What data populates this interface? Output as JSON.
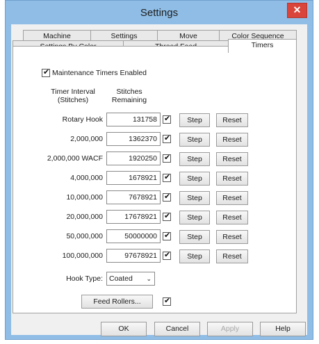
{
  "window": {
    "title": "Settings",
    "close_glyph": "✕"
  },
  "tabs_row1": [
    "Machine",
    "Settings",
    "Move",
    "Color Sequence"
  ],
  "tabs_row2": [
    "Settings By Color",
    "Thread Feed",
    "Timers"
  ],
  "active_tab": "Timers",
  "maintenance": {
    "label": "Maintenance Timers Enabled",
    "checked": true
  },
  "headers": {
    "interval_line1": "Timer Interval",
    "interval_line2": "(Stitches)",
    "remaining_line1": "Stitches",
    "remaining_line2": "Remaining"
  },
  "timers": [
    {
      "interval": "Rotary Hook",
      "remaining": "131758",
      "enabled": true
    },
    {
      "interval": "2,000,000",
      "remaining": "1362370",
      "enabled": true
    },
    {
      "interval": "2,000,000 WACF",
      "remaining": "1920250",
      "enabled": true
    },
    {
      "interval": "4,000,000",
      "remaining": "1678921",
      "enabled": true
    },
    {
      "interval": "10,000,000",
      "remaining": "7678921",
      "enabled": true
    },
    {
      "interval": "20,000,000",
      "remaining": "17678921",
      "enabled": true
    },
    {
      "interval": "50,000,000",
      "remaining": "50000000",
      "enabled": true
    },
    {
      "interval": "100,000,000",
      "remaining": "97678921",
      "enabled": true
    }
  ],
  "step_label": "Step",
  "reset_label": "Reset",
  "hook_type": {
    "label": "Hook Type:",
    "value": "Coated",
    "arrow": "⌄"
  },
  "feed_rollers": {
    "label": "Feed Rollers...",
    "checked": true
  },
  "buttons": {
    "ok": "OK",
    "cancel": "Cancel",
    "apply": "Apply",
    "help": "Help"
  }
}
